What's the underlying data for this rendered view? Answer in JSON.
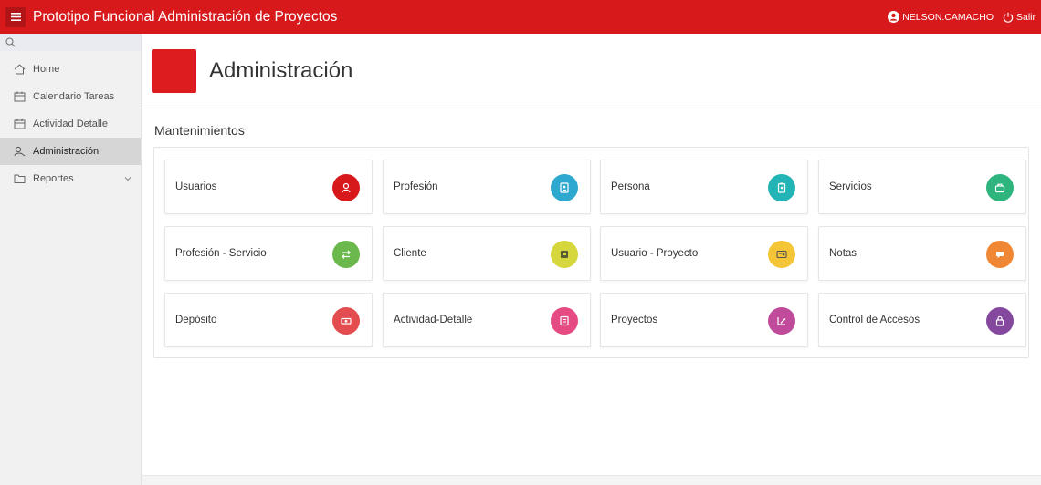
{
  "topbar": {
    "title": "Prototipo Funcional Administración de Proyectos",
    "user": "NELSON.CAMACHO",
    "logout": "Salir",
    "color": "#d7191c"
  },
  "sidebar": {
    "items": [
      {
        "label": "Home",
        "icon": "home-icon"
      },
      {
        "label": "Calendario Tareas",
        "icon": "calendar-icon"
      },
      {
        "label": "Actividad Detalle",
        "icon": "calendar-icon"
      },
      {
        "label": "Administración",
        "icon": "user-key-icon",
        "active": true
      },
      {
        "label": "Reportes",
        "icon": "folder-icon",
        "has_submenu": true
      }
    ]
  },
  "page": {
    "heading": "Administración",
    "section": "Mantenimientos"
  },
  "cards": [
    {
      "label": "Usuarios",
      "color": "#d7191c",
      "icon": "user-icon"
    },
    {
      "label": "Profesión",
      "color": "#2fa8d0",
      "icon": "id-badge-icon"
    },
    {
      "label": "Persona",
      "color": "#23b5b5",
      "icon": "clipboard-icon"
    },
    {
      "label": "Servicios",
      "color": "#2db57d",
      "icon": "briefcase-icon"
    },
    {
      "label": "Profesión - Servicio",
      "color": "#6bb94d",
      "icon": "swap-icon"
    },
    {
      "label": "Cliente",
      "color": "#d5d73c",
      "icon": "building-icon"
    },
    {
      "label": "Usuario - Proyecto",
      "color": "#f4c534",
      "icon": "user-card-icon"
    },
    {
      "label": "Notas",
      "color": "#f08734",
      "icon": "chat-icon"
    },
    {
      "label": "Depósito",
      "color": "#e34d50",
      "icon": "money-icon"
    },
    {
      "label": "Actividad-Detalle",
      "color": "#e54b82",
      "icon": "note-icon"
    },
    {
      "label": "Proyectos",
      "color": "#c04b9b",
      "icon": "edit-icon"
    },
    {
      "label": "Control de Accesos",
      "color": "#84489f",
      "icon": "lock-icon"
    }
  ]
}
